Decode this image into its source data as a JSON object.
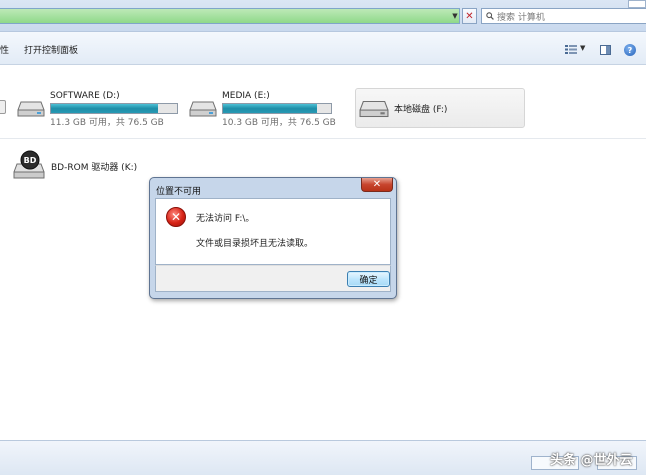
{
  "search": {
    "placeholder": "搜索 计算机"
  },
  "toolbar": {
    "tail_label": "性",
    "control_panel_label": "打开控制面板"
  },
  "drives": [
    {
      "name": "SOFTWARE (D:)",
      "space": "11.3 GB 可用，共 76.5 GB",
      "used_fraction": 0.85
    },
    {
      "name": "MEDIA (E:)",
      "space": "10.3 GB 可用，共 76.5 GB",
      "used_fraction": 0.87
    },
    {
      "name": "本地磁盘 (F:)"
    },
    {
      "name": "BD-ROM 驱动器 (K:)"
    }
  ],
  "dialog": {
    "title": "位置不可用",
    "close_glyph": "✕",
    "message_main": "无法访问 F:\\。",
    "message_detail": "文件或目录损坏且无法读取。",
    "ok_label": "确定"
  },
  "icons": {
    "address_close": "✕",
    "dropdown": "▼",
    "help": "?",
    "error": "✕",
    "bd_badge": "BD"
  },
  "watermark": "头条 @世外云"
}
